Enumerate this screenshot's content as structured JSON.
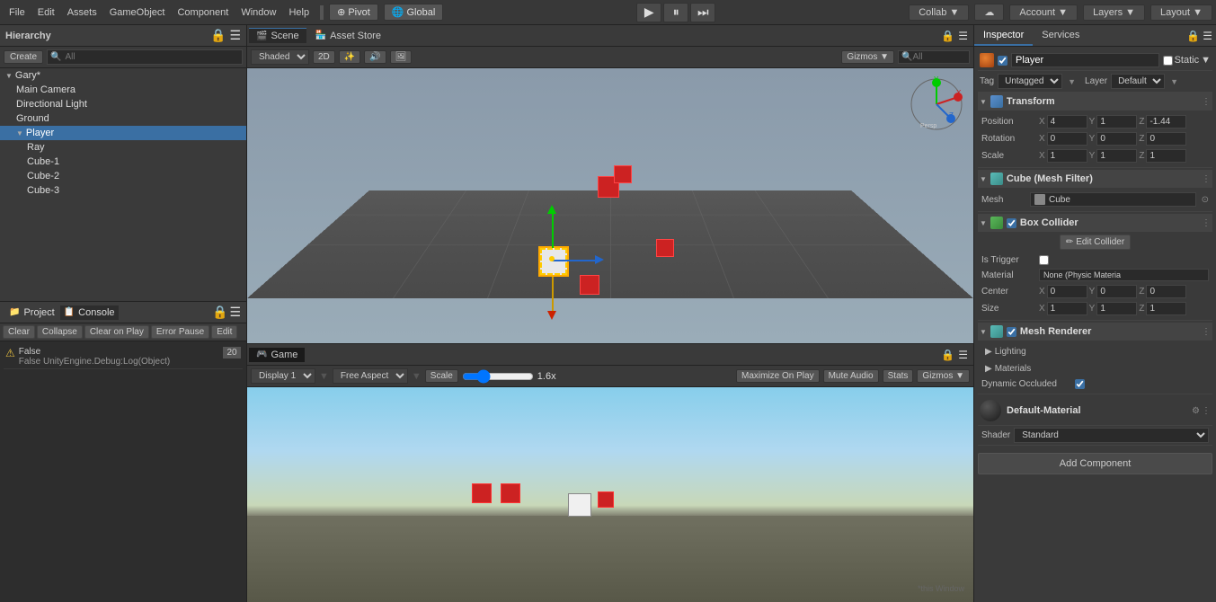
{
  "menubar": {
    "items": [
      "File",
      "Edit",
      "Assets",
      "GameObject",
      "Component",
      "Window",
      "Help"
    ],
    "pivot_label": "Pivot",
    "global_label": "Global",
    "play_icon": "▶",
    "pause_icon": "⏸",
    "step_icon": "⏭",
    "collab_label": "Collab ▼",
    "account_label": "Account ▼",
    "layers_label": "Layers ▼",
    "layout_label": "Layout ▼"
  },
  "hierarchy": {
    "title": "Hierarchy",
    "create_label": "Create",
    "search_placeholder": "All",
    "items": [
      {
        "name": "Gary*",
        "level": 0,
        "has_arrow": true,
        "selected": false
      },
      {
        "name": "Main Camera",
        "level": 1,
        "selected": false
      },
      {
        "name": "Directional Light",
        "level": 1,
        "selected": false
      },
      {
        "name": "Ground",
        "level": 1,
        "selected": false
      },
      {
        "name": "Player",
        "level": 1,
        "selected": true
      },
      {
        "name": "Ray",
        "level": 2,
        "selected": false
      },
      {
        "name": "Cube-1",
        "level": 2,
        "selected": false
      },
      {
        "name": "Cube-2",
        "level": 2,
        "selected": false
      },
      {
        "name": "Cube-3",
        "level": 2,
        "selected": false
      }
    ]
  },
  "console": {
    "title": "Console",
    "buttons": [
      "Clear",
      "Collapse",
      "Clear on Play",
      "Error Pause",
      "Edit"
    ],
    "items": [
      {
        "type": "warning",
        "text": "False\nUnityEngine.Debug:Log(Object)",
        "count": 20
      }
    ]
  },
  "scene": {
    "title": "Scene",
    "tab_asset_store": "Asset Store",
    "shading_mode": "Shaded",
    "view_2d": "2D",
    "gizmos_label": "Gizmos ▼",
    "search_placeholder": "All"
  },
  "game": {
    "title": "Game",
    "display": "Display 1",
    "aspect": "Free Aspect",
    "scale_label": "Scale",
    "scale_value": "1.6x",
    "maximize_label": "Maximize On Play",
    "mute_label": "Mute Audio",
    "stats_label": "Stats",
    "gizmos_label": "Gizmos ▼"
  },
  "inspector": {
    "title": "Inspector",
    "services_tab": "Services",
    "object_name": "Player",
    "is_static_label": "Static",
    "tag_label": "Tag",
    "tag_value": "Untagged",
    "layer_label": "Layer",
    "layer_value": "Default",
    "transform": {
      "title": "Transform",
      "position_label": "Position",
      "pos_x": "4",
      "pos_y": "1",
      "pos_z": "-1.44",
      "rotation_label": "Rotation",
      "rot_x": "0",
      "rot_y": "0",
      "rot_z": "0",
      "scale_label": "Scale",
      "scale_x": "1",
      "scale_y": "1",
      "scale_z": "1"
    },
    "mesh_filter": {
      "title": "Cube (Mesh Filter)",
      "mesh_label": "Mesh",
      "mesh_value": "Cube"
    },
    "box_collider": {
      "title": "Box Collider",
      "edit_label": "Edit Collider",
      "trigger_label": "Is Trigger",
      "material_label": "Material",
      "material_value": "None (Physic Materia",
      "center_label": "Center",
      "cx": "0",
      "cy": "0",
      "cz": "0",
      "size_label": "Size",
      "sx": "1",
      "sy": "1",
      "sz": "1"
    },
    "mesh_renderer": {
      "title": "Mesh Renderer",
      "lighting_label": "Lighting",
      "materials_label": "Materials",
      "dynamic_label": "Dynamic Occluded"
    },
    "material": {
      "name": "Default-Material",
      "shader_label": "Shader",
      "shader_value": "Standard"
    },
    "add_component_label": "Add Component"
  }
}
